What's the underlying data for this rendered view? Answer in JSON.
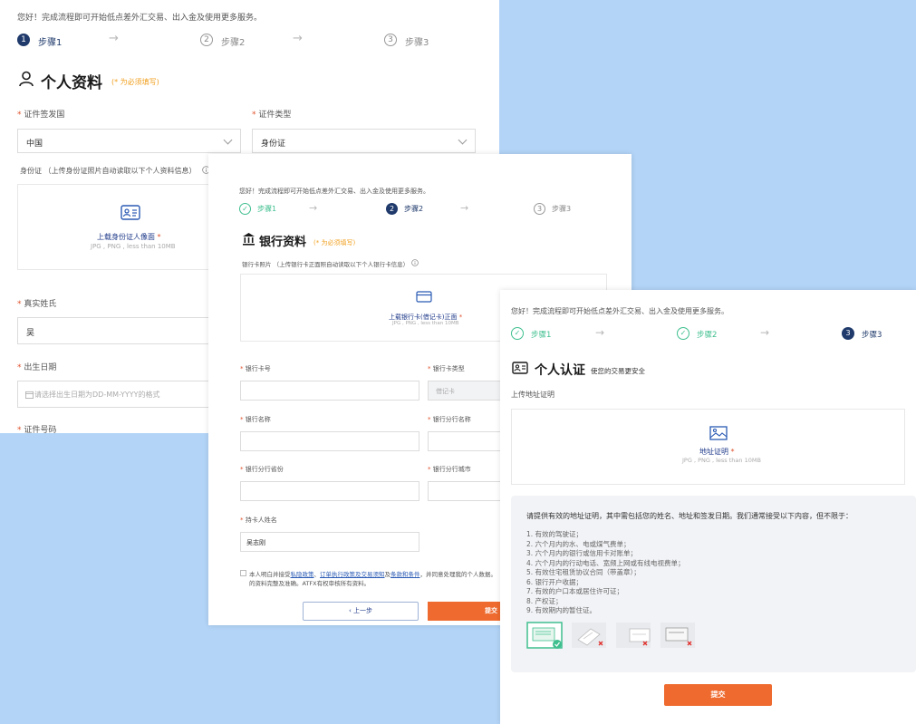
{
  "panel1": {
    "greeting": "您好！完成流程即可开始低点差外汇交易、出入金及使用更多服务。",
    "steps": [
      {
        "num": "1",
        "label": "步骤1"
      },
      {
        "num": "2",
        "label": "步骤2"
      },
      {
        "num": "3",
        "label": "步骤3"
      }
    ],
    "arrow": "→",
    "title": "个人资料",
    "required_note": "(* 为必须填写)",
    "issuing_country_label": "证件签发国",
    "issuing_country_value": "中国",
    "id_type_label": "证件类型",
    "id_type_value": "身份证",
    "id_upload_label": "身份证 （上传身份证照片自动读取以下个人资料信息）",
    "upload_text": "上载身份证人像面",
    "upload_hint": "JPG , PNG , less than 10MB",
    "real_name_label": "真实姓氏",
    "real_name_value": "吴",
    "dob_label": "出生日期",
    "dob_placeholder": "请选择出生日期为DD-MM-YYYY的格式",
    "id_number_label": "证件号码",
    "star": "*"
  },
  "panel2": {
    "greeting": "您好！完成流程即可开始低点差外汇交易、出入金及使用更多服务。",
    "steps": [
      {
        "num": "✓",
        "label": "步骤1"
      },
      {
        "num": "2",
        "label": "步骤2"
      },
      {
        "num": "3",
        "label": "步骤3"
      }
    ],
    "arrow": "→",
    "title": "银行资料",
    "required_note": "(* 为必须填写)",
    "card_photo_label": "银行卡照片 （上传银行卡正面照自动读取以下个人银行卡信息）",
    "upload_text": "上载银行卡(借记卡)正面",
    "upload_hint": "JPG , PNG , less than 10MB",
    "card_number_label": "银行卡号",
    "card_type_label": "银行卡类型",
    "card_type_value": "借记卡",
    "bank_name_label": "银行名称",
    "branch_name_label": "银行分行名称",
    "branch_province_label": "银行分行省份",
    "branch_city_label": "银行分行城市",
    "holder_label": "持卡人姓名",
    "holder_value": "吴志刚",
    "consent_prefix": "本人明白并接受",
    "consent_link1": "私隐政策",
    "consent_sep1": "、",
    "consent_link2": "订单执行政策及交易须知",
    "consent_mid": "及",
    "consent_link3": "条款和条件",
    "consent_suffix": "，并同意处理我的个人数据。",
    "consent_line2": "的资料完整及准确。ATFX有权审核所有资料。",
    "prev_button": "‹ 上一步",
    "submit_button": "提交",
    "star": "*"
  },
  "panel3": {
    "greeting": "您好！完成流程即可开始低点差外汇交易、出入金及使用更多服务。",
    "steps": [
      {
        "num": "✓",
        "label": "步骤1"
      },
      {
        "num": "✓",
        "label": "步骤2"
      },
      {
        "num": "3",
        "label": "步骤3"
      }
    ],
    "arrow": "→",
    "title": "个人认证",
    "subtitle": "使您的交易更安全",
    "proof_label": "上传地址证明",
    "upload_text": "地址证明",
    "upload_hint": "JPG , PNG , less than 10MB",
    "instructions_title": "请提供有效的地址证明，其中需包括您的姓名、地址和签发日期。我们通常接受以下内容，但不限于：",
    "instructions": [
      "1. 有效的驾驶证；",
      "2. 六个月内的水、电或煤气费单；",
      "3. 六个月内的银行或信用卡对账单；",
      "4. 六个月内的行动电话、宽频上网或有线电视费单；",
      "5. 有效住宅租赁协议合同（带盖章）；",
      "6. 银行开户收据；",
      "7. 有效的户口本或居住许可证；",
      "8. 产权证；",
      "9. 有效期内的暂住证。"
    ],
    "submit_button": "提交",
    "star": "*"
  },
  "colors": {
    "accent_navy": "#1f3a6b",
    "accent_orange": "#ef6a2e",
    "done_green": "#3fbf8f",
    "background_blue": "#b3d4f7"
  }
}
